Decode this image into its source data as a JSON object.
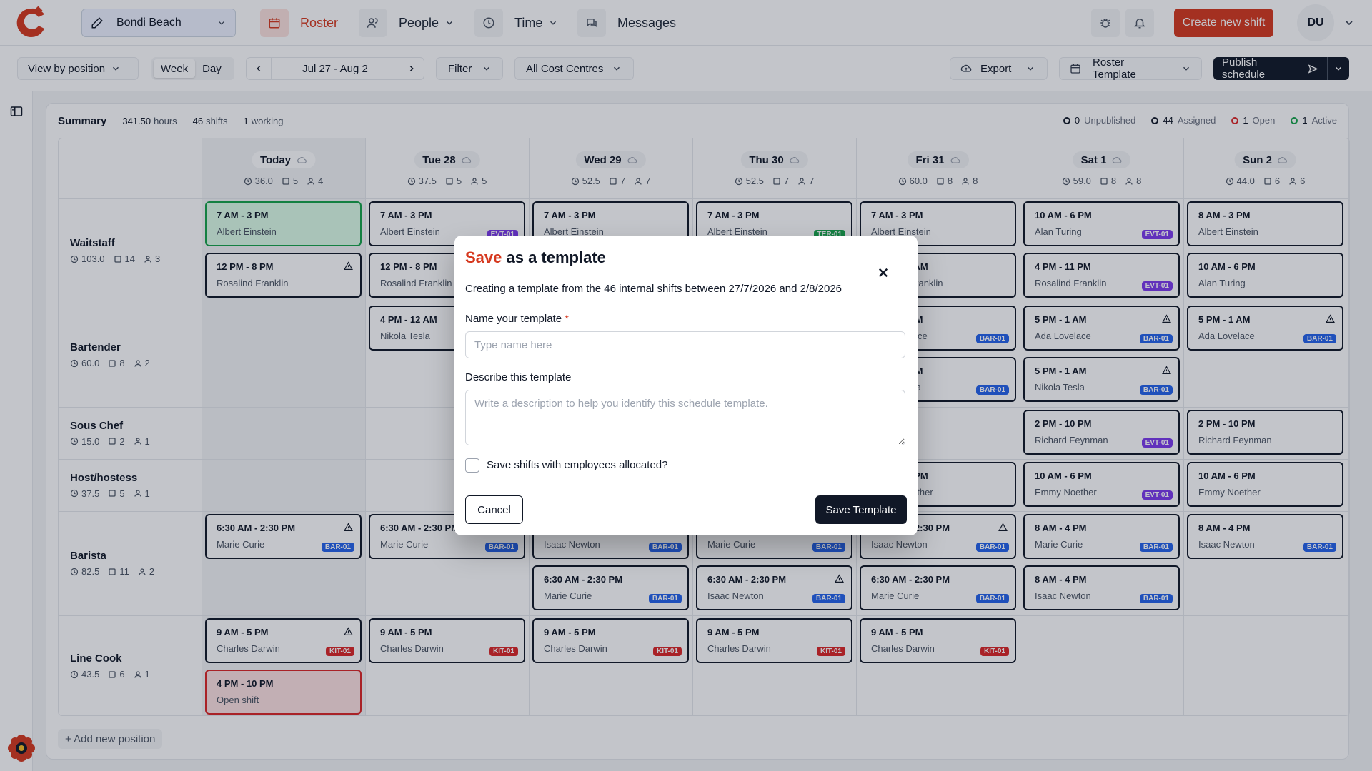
{
  "topbar": {
    "location": "Bondi Beach",
    "nav": [
      {
        "label": "Roster",
        "icon": "calendar-icon"
      },
      {
        "label": "People",
        "icon": "users-icon"
      },
      {
        "label": "Time",
        "icon": "clock-icon"
      },
      {
        "label": "Messages",
        "icon": "chat-icon"
      }
    ],
    "create_label": "Create new shift",
    "user_initials": "DU",
    "accent": "#d6381e"
  },
  "toolbar": {
    "view_by": "View by position",
    "week": "Week",
    "day": "Day",
    "date_range": "Jul 27 - Aug 2",
    "filter": "Filter",
    "cost_centres": "All Cost Centres",
    "export": "Export",
    "roster_template": "Roster Template",
    "publish": "Publish schedule"
  },
  "summary": {
    "title": "Summary",
    "hours_value": "341.50",
    "hours_label": "hours",
    "shifts_value": "46",
    "shifts_label": "shifts",
    "working_value": "1",
    "working_label": "working",
    "unpublished_value": "0",
    "unpublished_label": "Unpublished",
    "assigned_value": "44",
    "assigned_label": "Assigned",
    "open_value": "1",
    "open_label": "Open",
    "active_value": "1",
    "active_label": "Active"
  },
  "days": [
    {
      "label": "Today",
      "hours": "36.0",
      "shifts": "5",
      "people": "4"
    },
    {
      "label": "Tue 28",
      "hours": "37.5",
      "shifts": "5",
      "people": "5"
    },
    {
      "label": "Wed 29",
      "hours": "52.5",
      "shifts": "7",
      "people": "7"
    },
    {
      "label": "Thu 30",
      "hours": "52.5",
      "shifts": "7",
      "people": "7"
    },
    {
      "label": "Fri 31",
      "hours": "60.0",
      "shifts": "8",
      "people": "8"
    },
    {
      "label": "Sat 1",
      "hours": "59.0",
      "shifts": "8",
      "people": "8"
    },
    {
      "label": "Sun 2",
      "hours": "44.0",
      "shifts": "6",
      "people": "6"
    }
  ],
  "positions": [
    {
      "name": "Waitstaff",
      "hours": "103.0",
      "shifts": "14",
      "people": "3"
    },
    {
      "name": "Bartender",
      "hours": "60.0",
      "shifts": "8",
      "people": "2"
    },
    {
      "name": "Sous Chef",
      "hours": "15.0",
      "shifts": "2",
      "people": "1"
    },
    {
      "name": "Host/hostess",
      "hours": "37.5",
      "shifts": "5",
      "people": "1"
    },
    {
      "name": "Barista",
      "hours": "82.5",
      "shifts": "11",
      "people": "2"
    },
    {
      "name": "Line Cook",
      "hours": "43.5",
      "shifts": "6",
      "people": "1"
    }
  ],
  "shifts": [
    {
      "time": "7 AM - 3 PM",
      "name": "Albert Einstein",
      "tag": "",
      "warn": false,
      "style": "green"
    },
    {
      "time": "12 PM - 8 PM",
      "name": "Rosalind Franklin",
      "tag": "",
      "warn": true,
      "style": ""
    },
    {
      "time": "6:30 AM - 2:30 PM",
      "name": "Marie Curie",
      "tag": "BAR-01",
      "warn": true,
      "style": ""
    },
    {
      "time": "9 AM - 5 PM",
      "name": "Charles Darwin",
      "tag": "KIT-01",
      "warn": true,
      "style": ""
    },
    {
      "time": "4 PM - 10 PM",
      "name": "Open shift",
      "tag": "",
      "warn": false,
      "style": "red"
    },
    {
      "time": "7 AM - 3 PM",
      "name": "Albert Einstein",
      "tag": "EVT-01",
      "warn": false,
      "style": ""
    },
    {
      "time": "12 PM - 8 PM",
      "name": "Rosalind Franklin",
      "tag": "",
      "warn": false,
      "style": ""
    },
    {
      "time": "4 PM - 12 AM",
      "name": "Nikola Tesla",
      "tag": "",
      "warn": false,
      "style": ""
    },
    {
      "time": "6:30 AM - 2:30 PM",
      "name": "Marie Curie",
      "tag": "BAR-01",
      "warn": false,
      "style": ""
    },
    {
      "time": "9 AM - 5 PM",
      "name": "Charles Darwin",
      "tag": "KIT-01",
      "warn": false,
      "style": ""
    },
    {
      "time": "7 AM - 3 PM",
      "name": "Albert Einstein",
      "tag": "",
      "warn": false,
      "style": ""
    },
    {
      "time": "6:30 AM - 2:30 PM",
      "name": "Isaac Newton",
      "tag": "BAR-01",
      "warn": false,
      "style": ""
    },
    {
      "time": "6:30 AM - 2:30 PM",
      "name": "Marie Curie",
      "tag": "BAR-01",
      "warn": false,
      "style": ""
    },
    {
      "time": "9 AM - 5 PM",
      "name": "Charles Darwin",
      "tag": "KIT-01",
      "warn": false,
      "style": ""
    },
    {
      "time": "7 AM - 3 PM",
      "name": "Albert Einstein",
      "tag": "TER-01",
      "warn": false,
      "style": ""
    },
    {
      "time": "6:30 AM - 2:30 PM",
      "name": "Marie Curie",
      "tag": "BAR-01",
      "warn": false,
      "style": ""
    },
    {
      "time": "6:30 AM - 2:30 PM",
      "name": "Isaac Newton",
      "tag": "BAR-01",
      "warn": true,
      "style": ""
    },
    {
      "time": "9 AM - 5 PM",
      "name": "Charles Darwin",
      "tag": "KIT-01",
      "warn": false,
      "style": ""
    },
    {
      "time": "7 AM - 3 PM",
      "name": "Albert Einstein",
      "tag": "",
      "warn": false,
      "style": ""
    },
    {
      "time": "4 PM - 12 AM",
      "name": "Rosalind Franklin",
      "tag": "",
      "warn": false,
      "style": ""
    },
    {
      "time": "5 PM - 1 AM",
      "name": "Ada Lovelace",
      "tag": "BAR-01",
      "warn": false,
      "style": ""
    },
    {
      "time": "5 PM - 1 AM",
      "name": "Nikola Tesla",
      "tag": "BAR-01",
      "warn": false,
      "style": ""
    },
    {
      "time": "10 AM - 6 PM",
      "name": "Emmy Noether",
      "tag": "",
      "warn": false,
      "style": ""
    },
    {
      "time": "6:30 AM - 2:30 PM",
      "name": "Isaac Newton",
      "tag": "BAR-01",
      "warn": true,
      "style": ""
    },
    {
      "time": "6:30 AM - 2:30 PM",
      "name": "Marie Curie",
      "tag": "BAR-01",
      "warn": false,
      "style": ""
    },
    {
      "time": "9 AM - 5 PM",
      "name": "Charles Darwin",
      "tag": "KIT-01",
      "warn": false,
      "style": ""
    },
    {
      "time": "10 AM - 6 PM",
      "name": "Alan Turing",
      "tag": "EVT-01",
      "warn": false,
      "style": ""
    },
    {
      "time": "4 PM - 11 PM",
      "name": "Rosalind Franklin",
      "tag": "EVT-01",
      "warn": false,
      "style": ""
    },
    {
      "time": "5 PM - 1 AM",
      "name": "Ada Lovelace",
      "tag": "BAR-01",
      "warn": true,
      "style": ""
    },
    {
      "time": "5 PM - 1 AM",
      "name": "Nikola Tesla",
      "tag": "BAR-01",
      "warn": true,
      "style": ""
    },
    {
      "time": "2 PM - 10 PM",
      "name": "Richard Feynman",
      "tag": "EVT-01",
      "warn": false,
      "style": ""
    },
    {
      "time": "10 AM - 6 PM",
      "name": "Emmy Noether",
      "tag": "EVT-01",
      "warn": false,
      "style": ""
    },
    {
      "time": "8 AM - 4 PM",
      "name": "Marie Curie",
      "tag": "BAR-01",
      "warn": false,
      "style": ""
    },
    {
      "time": "8 AM - 4 PM",
      "name": "Isaac Newton",
      "tag": "BAR-01",
      "warn": false,
      "style": ""
    },
    {
      "time": "8 AM - 3 PM",
      "name": "Albert Einstein",
      "tag": "",
      "warn": false,
      "style": ""
    },
    {
      "time": "10 AM - 6 PM",
      "name": "Alan Turing",
      "tag": "",
      "warn": false,
      "style": ""
    },
    {
      "time": "5 PM - 1 AM",
      "name": "Ada Lovelace",
      "tag": "BAR-01",
      "warn": true,
      "style": ""
    },
    {
      "time": "2 PM - 10 PM",
      "name": "Richard Feynman",
      "tag": "",
      "warn": false,
      "style": ""
    },
    {
      "time": "10 AM - 6 PM",
      "name": "Emmy Noether",
      "tag": "",
      "warn": false,
      "style": ""
    },
    {
      "time": "8 AM - 4 PM",
      "name": "Isaac Newton",
      "tag": "BAR-01",
      "warn": false,
      "style": ""
    }
  ],
  "add_position": "+ Add new position",
  "modal": {
    "title_accent": "Save",
    "title_rest": " as a template",
    "description": "Creating a template from the 46 internal shifts between 27/7/2026 and 2/8/2026",
    "name_label": "Name your template",
    "required_mark": "*",
    "name_placeholder": "Type name here",
    "describe_label": "Describe this template",
    "describe_placeholder": "Write a description to help you identify this schedule template.",
    "checkbox_label": "Save shifts with employees allocated?",
    "cancel": "Cancel",
    "save": "Save Template"
  }
}
